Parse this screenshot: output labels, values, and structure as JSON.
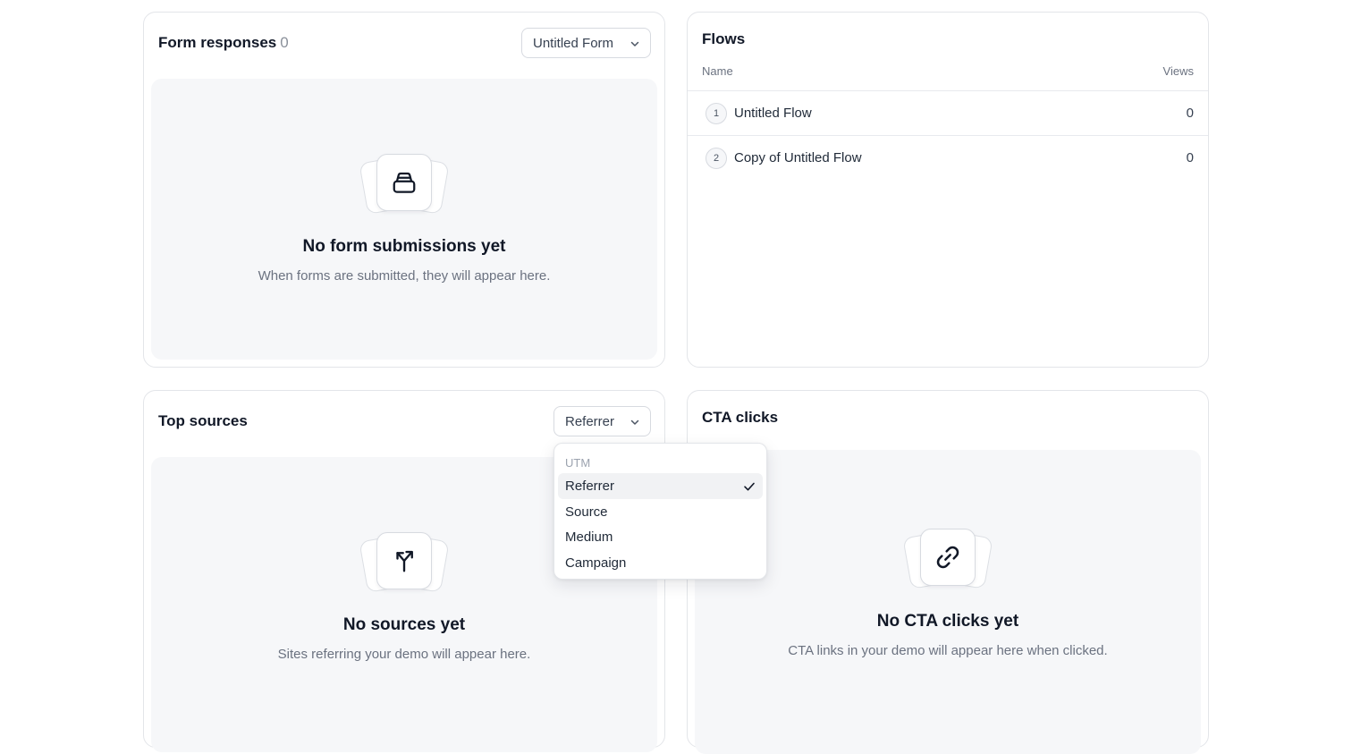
{
  "form_responses": {
    "title": "Form responses",
    "count": "0",
    "form_select": "Untitled Form",
    "empty_title": "No form submissions yet",
    "empty_desc": "When forms are submitted, they will appear here.",
    "icon": "inbox-icon"
  },
  "flows": {
    "title": "Flows",
    "col_name": "Name",
    "col_views": "Views",
    "rows": [
      {
        "index": "1",
        "name": "Untitled Flow",
        "views": "0"
      },
      {
        "index": "2",
        "name": "Copy of Untitled Flow",
        "views": "0"
      }
    ]
  },
  "top_sources": {
    "title": "Top sources",
    "select_value": "Referrer",
    "empty_title": "No sources yet",
    "empty_desc": "Sites referring your demo will appear here.",
    "icon": "split-arrow-icon",
    "dropdown": {
      "group_label": "UTM",
      "options": [
        "Referrer",
        "Source",
        "Medium",
        "Campaign"
      ],
      "selected": "Referrer"
    }
  },
  "cta_clicks": {
    "title": "CTA clicks",
    "empty_title": "No CTA clicks yet",
    "empty_desc": "CTA links in your demo will appear here when clicked.",
    "icon": "link-icon"
  }
}
